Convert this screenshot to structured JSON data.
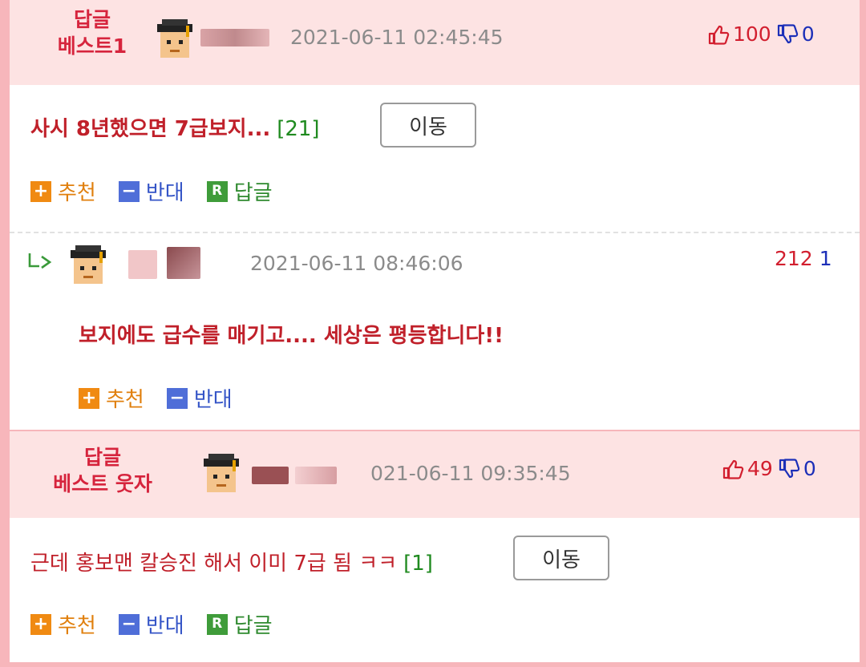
{
  "best1": {
    "label_line1": "답글",
    "label_line2": "베스트1",
    "timestamp": "2021-06-11 02:45:45",
    "upvotes": "100",
    "downvotes": "0",
    "title": "사시 8년했으면 7급보지...",
    "comment_count": "[21]",
    "move_label": "이동",
    "actions": {
      "recommend": "추천",
      "oppose": "반대",
      "reply": "답글"
    }
  },
  "reply": {
    "timestamp": "2021-06-11 08:46:06",
    "upvotes": "212",
    "downvotes": "1",
    "body": "보지에도 급수를 매기고.... 세상은 평등합니다!!",
    "actions": {
      "recommend": "추천",
      "oppose": "반대"
    }
  },
  "best_laugh": {
    "label_line1": "답글",
    "label_line2": "베스트 웃자",
    "timestamp": "021-06-11 09:35:45",
    "upvotes": "49",
    "downvotes": "0",
    "title": "근데 홍보맨 칼승진 해서 이미 7급 됨 ㅋㅋ",
    "comment_count": "[1]",
    "move_label": "이동",
    "actions": {
      "recommend": "추천",
      "oppose": "반대",
      "reply": "답글"
    }
  },
  "icons": {
    "plus": "+",
    "minus": "−",
    "reply_badge": "R",
    "thumbs_up": "thumbs-up-icon",
    "thumbs_down": "thumbs-down-icon",
    "reply_arrow": "reply-arrow-icon",
    "avatar": "graduate-avatar"
  },
  "colors": {
    "border": "#f7b6bb",
    "header_bg": "#fde3e3",
    "best_label": "#d6243d",
    "title_red": "#c0202a",
    "count_green": "#1f8a1f",
    "up_red": "#d21f2f",
    "down_blue": "#1c2fb8"
  }
}
